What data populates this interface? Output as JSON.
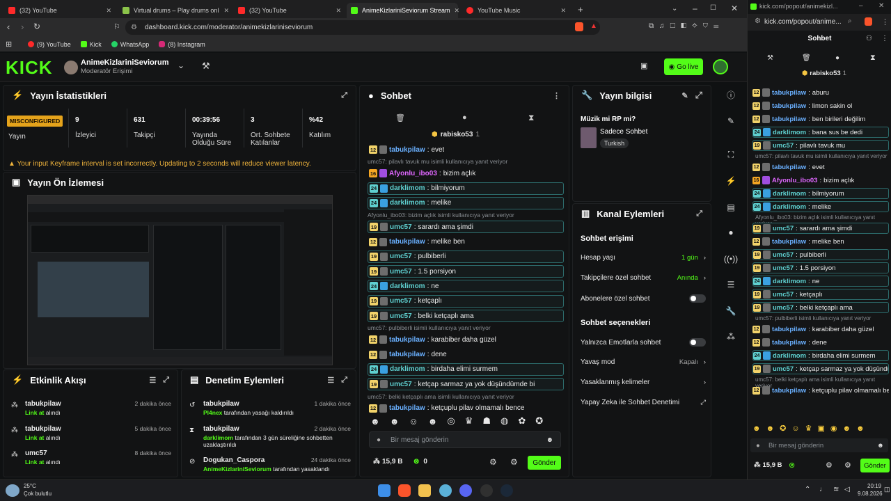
{
  "browser": {
    "tabs": [
      {
        "label": "(32) YouTube",
        "color": "#ff2a2a"
      },
      {
        "label": "Virtual drums – Play drums online | M",
        "color": "#8bc34a"
      },
      {
        "label": "(32) YouTube",
        "color": "#ff2a2a"
      },
      {
        "label": "AnimeKizlariniSeviorum Stream",
        "color": "#53fc18"
      },
      {
        "label": "YouTube Music",
        "color": "#ff2a2a"
      }
    ],
    "url": "dashboard.kick.com/moderator/animekizlariniseviorum",
    "bookmarks": [
      "(9) YouTube",
      "Kick",
      "WhatsApp",
      "(8) Instagram"
    ]
  },
  "header": {
    "logo": "KICK",
    "channel_name": "AnimeKizlariniSeviorum",
    "role": "Moderatör Erişimi",
    "go_live": "Go live"
  },
  "stats": {
    "title": "Yayın İstatistikleri",
    "status_badge": "MISCONFIGURED",
    "status_label": "Yayın",
    "items": [
      {
        "value": "9",
        "label": "İzleyici"
      },
      {
        "value": "631",
        "label": "Takipçi"
      },
      {
        "value": "00:39:56",
        "label": "Yayında Olduğu Süre"
      },
      {
        "value": "3",
        "label": "Ort. Sohbete Katılanlar"
      },
      {
        "value": "%42",
        "label": "Katılım"
      }
    ],
    "warning": "Your input Keyframe interval is set incorrectly. Updating to 2 seconds will reduce viewer latency."
  },
  "preview": {
    "title": "Yayın Ön İzlemesi"
  },
  "activity": {
    "title": "Etkinlik Akışı",
    "items": [
      {
        "user": "tabukpilaw",
        "action": "Link at",
        "suffix": "alındı",
        "time": "2 dakika önce"
      },
      {
        "user": "tabukpilaw",
        "action": "Link at",
        "suffix": "alındı",
        "time": "5 dakika önce"
      },
      {
        "user": "umc57",
        "action": "Link at",
        "suffix": "alındı",
        "time": "8 dakika önce"
      }
    ]
  },
  "moderation": {
    "title": "Denetim Eylemleri",
    "items": [
      {
        "user": "tabukpilaw",
        "actor": "Pl4nex",
        "text": "tarafından yasağı kaldırıldı",
        "time": "1 dakika önce"
      },
      {
        "user": "tabukpilaw",
        "actor": "darklimom",
        "text": "tarafından 3 gün süreliğine sohbetten uzaklaştırıldı",
        "time": "2 dakika önce"
      },
      {
        "user": "Dogukan_Caspora",
        "actor": "AnimeKizlariniSeviorum",
        "text": "tarafından yasaklandı",
        "time": "24 dakika önce"
      }
    ]
  },
  "chat": {
    "title": "Sohbet",
    "pinned_user": "rabisko53",
    "pinned_count": "1",
    "input_placeholder": "Bir mesaj gönderin",
    "kicks": "15,9 B",
    "points": "0",
    "send": "Gönder",
    "messages": [
      {
        "lvl": "12",
        "lc": "y",
        "user": "tabukpilaw",
        "uc": "#6ab0ff",
        "text": "evet",
        "hl": false
      },
      {
        "reply": "umc57: pilavlı tavuk mu isimli kullanıcıya yanıt veriyor"
      },
      {
        "lvl": "16",
        "lc": "o",
        "user": "Afyonlu_ibo03",
        "uc": "#e067ff",
        "text": "bizim açlık",
        "hl": false
      },
      {
        "lvl": "24",
        "lc": "b",
        "user": "darklimom",
        "uc": "#5fd0d0",
        "text": "bilmiyorum",
        "hl": true
      },
      {
        "lvl": "24",
        "lc": "b",
        "user": "darklimom",
        "uc": "#5fd0d0",
        "text": "melike",
        "hl": true
      },
      {
        "reply": "Afyonlu_ibo03: bizim açlık isimli kullanıcıya yanıt veriyor"
      },
      {
        "lvl": "19",
        "lc": "y",
        "user": "umc57",
        "uc": "#5fd0d0",
        "text": "sarardı ama şimdi",
        "hl": true
      },
      {
        "lvl": "12",
        "lc": "y",
        "user": "tabukpilaw",
        "uc": "#6ab0ff",
        "text": "melike ben",
        "hl": false
      },
      {
        "lvl": "19",
        "lc": "y",
        "user": "umc57",
        "uc": "#5fd0d0",
        "text": "pulbiberli",
        "hl": true
      },
      {
        "lvl": "19",
        "lc": "y",
        "user": "umc57",
        "uc": "#5fd0d0",
        "text": "1.5 porsiyon",
        "hl": true
      },
      {
        "lvl": "24",
        "lc": "b",
        "user": "darklimom",
        "uc": "#5fd0d0",
        "text": "ne",
        "hl": true
      },
      {
        "lvl": "19",
        "lc": "y",
        "user": "umc57",
        "uc": "#5fd0d0",
        "text": "ketçaplı",
        "hl": true
      },
      {
        "lvl": "19",
        "lc": "y",
        "user": "umc57",
        "uc": "#5fd0d0",
        "text": "belki ketçaplı ama",
        "hl": true
      },
      {
        "reply": "umc57: pulbiberli isimli kullanıcıya yanıt veriyor"
      },
      {
        "lvl": "12",
        "lc": "y",
        "user": "tabukpilaw",
        "uc": "#6ab0ff",
        "text": "karabiber daha güzel",
        "hl": false
      },
      {
        "lvl": "12",
        "lc": "y",
        "user": "tabukpilaw",
        "uc": "#6ab0ff",
        "text": "dene",
        "hl": false
      },
      {
        "lvl": "24",
        "lc": "b",
        "user": "darklimom",
        "uc": "#5fd0d0",
        "text": "birdaha elimi surmem",
        "hl": true
      },
      {
        "lvl": "19",
        "lc": "y",
        "user": "umc57",
        "uc": "#5fd0d0",
        "text": "ketçap sarmaz ya yok düşündümde bi",
        "hl": true
      },
      {
        "reply": "umc57: belki ketçaplı ama isimli kullanıcıya yanıt veriyor"
      },
      {
        "lvl": "12",
        "lc": "y",
        "user": "tabukpilaw",
        "uc": "#6ab0ff",
        "text": "ketçuplu pilav olmamalı bence",
        "hl": false
      }
    ]
  },
  "stream_info": {
    "title": "Yayın bilgisi",
    "stream_title": "Müzik mi RP mi?",
    "category": "Sadece Sohbet",
    "language": "Turkish"
  },
  "channel_actions": {
    "title": "Kanal Eylemleri",
    "chat_access": "Sohbet erişimi",
    "account_age": "Hesap yaşı",
    "account_age_val": "1 gün",
    "follower_chat": "Takipçilere özel sohbet",
    "follower_chat_val": "Anında",
    "sub_chat": "Abonelere özel sohbet",
    "chat_options": "Sohbet seçenekleri",
    "emote_only": "Yalnızca Emotlarla sohbet",
    "slow_mode": "Yavaş mod",
    "slow_mode_val": "Kapalı",
    "banned_words": "Yasaklanmış kelimeler",
    "ai_mod": "Yapay Zeka ile Sohbet Denetimi"
  },
  "popout": {
    "url": "kick.com/popout/animekizl...",
    "url_full": "kick.com/popout/anime...",
    "title": "Sohbet",
    "pinned_user": "rabisko53",
    "pinned_count": "1",
    "input_placeholder": "Bir mesaj gönderin",
    "kicks": "15,9 B",
    "send": "Gönder",
    "messages": [
      {
        "lvl": "12",
        "lc": "y",
        "user": "tabukpilaw",
        "uc": "#6ab0ff",
        "text": "aburu",
        "hl": false
      },
      {
        "lvl": "12",
        "lc": "y",
        "user": "tabukpilaw",
        "uc": "#6ab0ff",
        "text": "limon sakin ol",
        "hl": false
      },
      {
        "lvl": "12",
        "lc": "y",
        "user": "tabukpilaw",
        "uc": "#6ab0ff",
        "text": "ben birileri değilim",
        "hl": false
      },
      {
        "lvl": "24",
        "lc": "b",
        "user": "darklimom",
        "uc": "#5fd0d0",
        "text": "bana sus be dedi",
        "hl": true
      },
      {
        "lvl": "19",
        "lc": "y",
        "user": "umc57",
        "uc": "#5fd0d0",
        "text": "pilavlı tavuk mu",
        "hl": true
      },
      {
        "reply": "umc57: pilavlı tavuk mu isimli kullanıcıya yanıt veriyor"
      },
      {
        "lvl": "12",
        "lc": "y",
        "user": "tabukpilaw",
        "uc": "#6ab0ff",
        "text": "evet",
        "hl": false
      },
      {
        "lvl": "16",
        "lc": "o",
        "user": "Afyonlu_ibo03",
        "uc": "#e067ff",
        "text": "bizim açlık",
        "hl": false
      },
      {
        "lvl": "24",
        "lc": "b",
        "user": "darklimom",
        "uc": "#5fd0d0",
        "text": "bilmiyorum",
        "hl": true
      },
      {
        "lvl": "24",
        "lc": "b",
        "user": "darklimom",
        "uc": "#5fd0d0",
        "text": "melike",
        "hl": true
      },
      {
        "reply": "Afyonlu_ibo03: bizim açlık isimli kullanıcıya yanıt veriyor"
      },
      {
        "lvl": "19",
        "lc": "y",
        "user": "umc57",
        "uc": "#5fd0d0",
        "text": "sarardı ama şimdi",
        "hl": true
      },
      {
        "lvl": "12",
        "lc": "y",
        "user": "tabukpilaw",
        "uc": "#6ab0ff",
        "text": "melike ben",
        "hl": false
      },
      {
        "lvl": "19",
        "lc": "y",
        "user": "umc57",
        "uc": "#5fd0d0",
        "text": "pulbiberli",
        "hl": true
      },
      {
        "lvl": "19",
        "lc": "y",
        "user": "umc57",
        "uc": "#5fd0d0",
        "text": "1.5 porsiyon",
        "hl": true
      },
      {
        "lvl": "24",
        "lc": "b",
        "user": "darklimom",
        "uc": "#5fd0d0",
        "text": "ne",
        "hl": true
      },
      {
        "lvl": "19",
        "lc": "y",
        "user": "umc57",
        "uc": "#5fd0d0",
        "text": "ketçaplı",
        "hl": true
      },
      {
        "lvl": "19",
        "lc": "y",
        "user": "umc57",
        "uc": "#5fd0d0",
        "text": "belki ketçaplı ama",
        "hl": true
      },
      {
        "reply": "umc57: pulbiberli isimli kullanıcıya yanıt veriyor"
      },
      {
        "lvl": "12",
        "lc": "y",
        "user": "tabukpilaw",
        "uc": "#6ab0ff",
        "text": "karabiber daha güzel",
        "hl": false
      },
      {
        "lvl": "12",
        "lc": "y",
        "user": "tabukpilaw",
        "uc": "#6ab0ff",
        "text": "dene",
        "hl": false
      },
      {
        "lvl": "24",
        "lc": "b",
        "user": "darklimom",
        "uc": "#5fd0d0",
        "text": "birdaha elimi surmem",
        "hl": true
      },
      {
        "lvl": "19",
        "lc": "y",
        "user": "umc57",
        "uc": "#5fd0d0",
        "text": "ketçap sarmaz ya yok düşündümde bi",
        "hl": true
      },
      {
        "reply": "umc57: belki ketçaplı ama isimli kullanıcıya yanıt veriyor"
      },
      {
        "lvl": "12",
        "lc": "y",
        "user": "tabukpilaw",
        "uc": "#6ab0ff",
        "text": "ketçuplu pilav olmamalı bence",
        "hl": false
      }
    ]
  },
  "taskbar": {
    "temp": "25°C",
    "weather": "Çok bulutlu",
    "time": "20:19",
    "date": "9.08.2026"
  }
}
